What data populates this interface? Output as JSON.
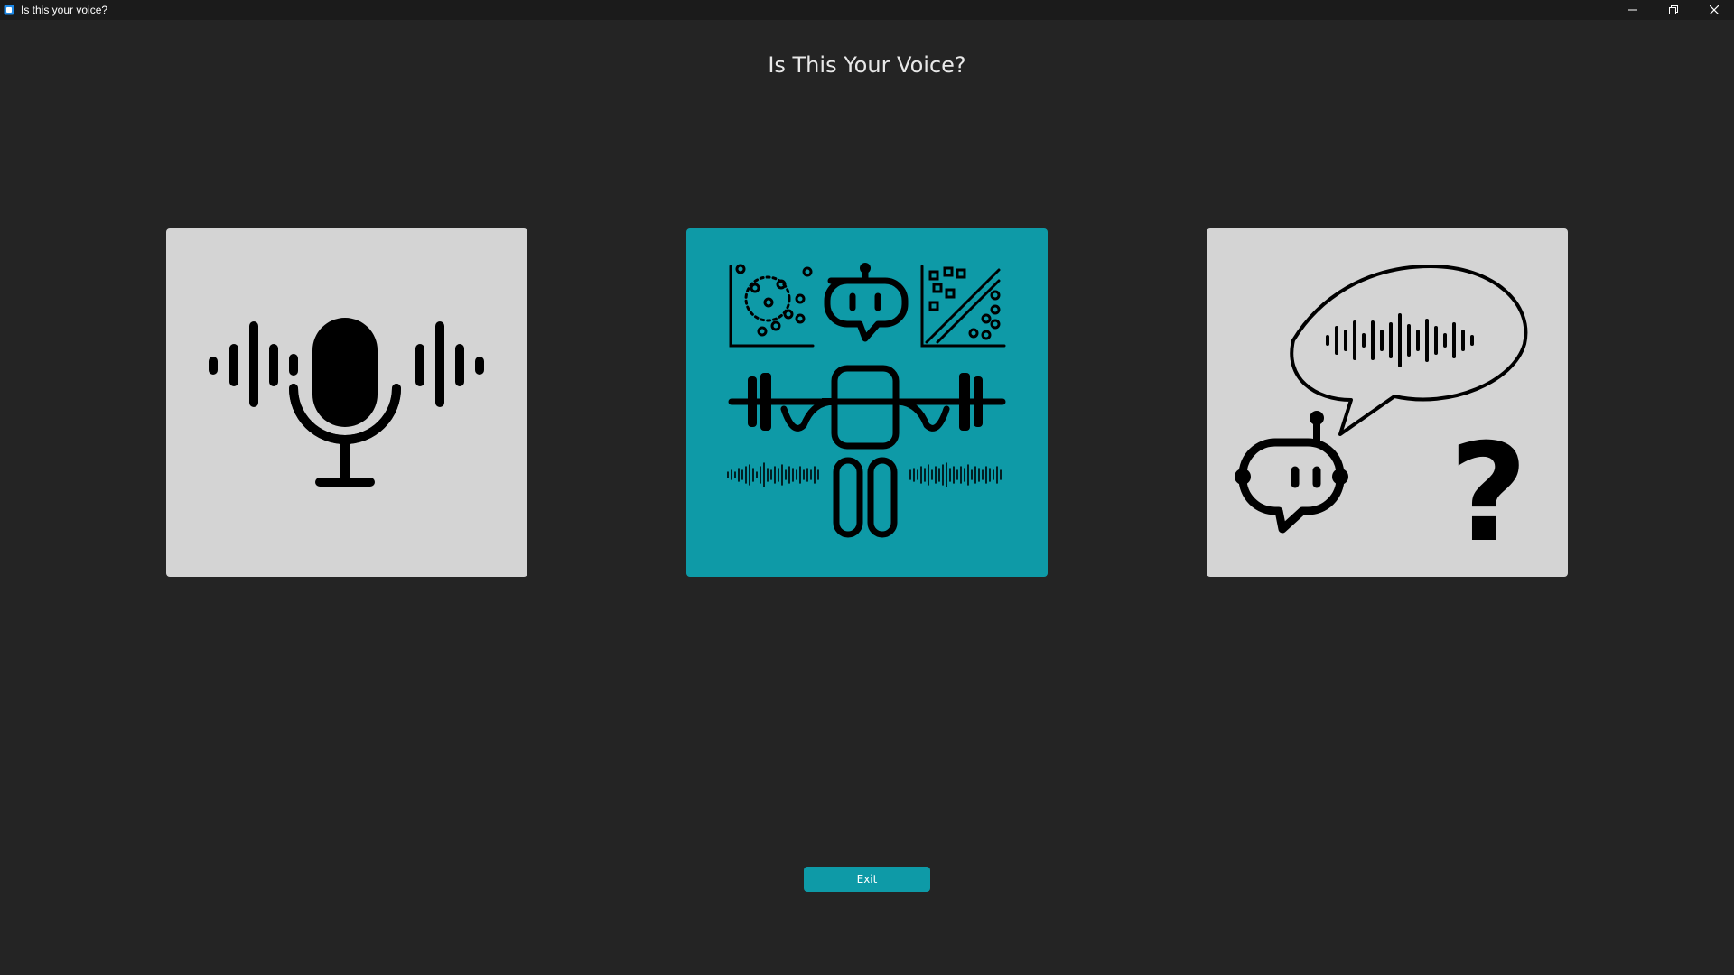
{
  "window": {
    "title": "Is this your voice?",
    "icon": "app-icon",
    "controls": [
      "minimize-icon",
      "restore-icon",
      "close-icon"
    ]
  },
  "page": {
    "title": "Is This Your Voice?"
  },
  "options": [
    {
      "icon": "microphone-soundwave-icon",
      "selected": false
    },
    {
      "icon": "robot-training-icon",
      "selected": true
    },
    {
      "icon": "robot-question-icon",
      "selected": false
    }
  ],
  "buttons": {
    "exit_label": "Exit"
  },
  "colors": {
    "background": "#242424",
    "titlebar": "#1b1b1b",
    "accent": "#0e9aa7",
    "card": "#d4d4d4",
    "icon": "#000000",
    "text": "#e8e8e8"
  }
}
